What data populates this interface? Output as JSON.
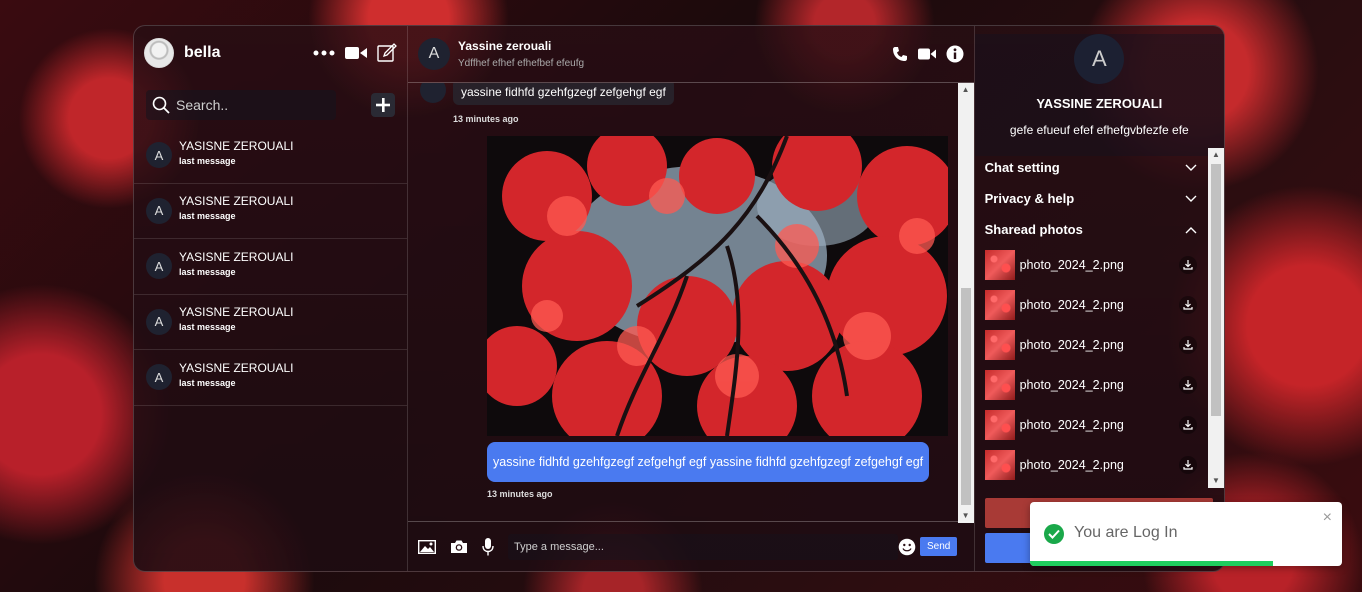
{
  "sidebar": {
    "username": "bella",
    "search_placeholder": "Search..",
    "contacts": [
      {
        "initial": "A",
        "name": "YASISNE ZEROUALI",
        "last": "last message"
      },
      {
        "initial": "A",
        "name": "YASISNE ZEROUALI",
        "last": "last message"
      },
      {
        "initial": "A",
        "name": "YASISNE ZEROUALI",
        "last": "last message"
      },
      {
        "initial": "A",
        "name": "YASISNE ZEROUALI",
        "last": "last message"
      },
      {
        "initial": "A",
        "name": "YASISNE ZEROUALI",
        "last": "last message"
      }
    ]
  },
  "chat": {
    "initial": "A",
    "name": "Yassine zerouali",
    "status": "Ydffhef efhef efhefbef efeufg",
    "messages": {
      "incoming_text": "yassine fidhfd gzehfgzegf zefgehgf egf",
      "incoming_time": "13 minutes ago",
      "outgoing_text": "yassine fidhfd gzehfgzegf zefgehgf egf yassine fidhfd gzehfgzegf zefgehgf egf",
      "outgoing_time": "13 minutes ago"
    },
    "composer": {
      "placeholder": "Type a message...",
      "send_label": "Send"
    }
  },
  "info": {
    "initial": "A",
    "name": "YASSINE ZEROUALI",
    "description": "gefe efueuf efef efhefgvbfezfe efe",
    "sections": {
      "chat_setting": "Chat setting",
      "privacy": "Privacy & help",
      "shared": "Sharead photos"
    },
    "shared_photos": [
      "photo_2024_2.png",
      "photo_2024_2.png",
      "photo_2024_2.png",
      "photo_2024_2.png",
      "photo_2024_2.png",
      "photo_2024_2.png"
    ]
  },
  "toast": {
    "message": "You are Log In",
    "close": "×"
  },
  "colors": {
    "accent": "#4a7af0",
    "success": "#1aa84a",
    "danger": "#a83a36"
  }
}
